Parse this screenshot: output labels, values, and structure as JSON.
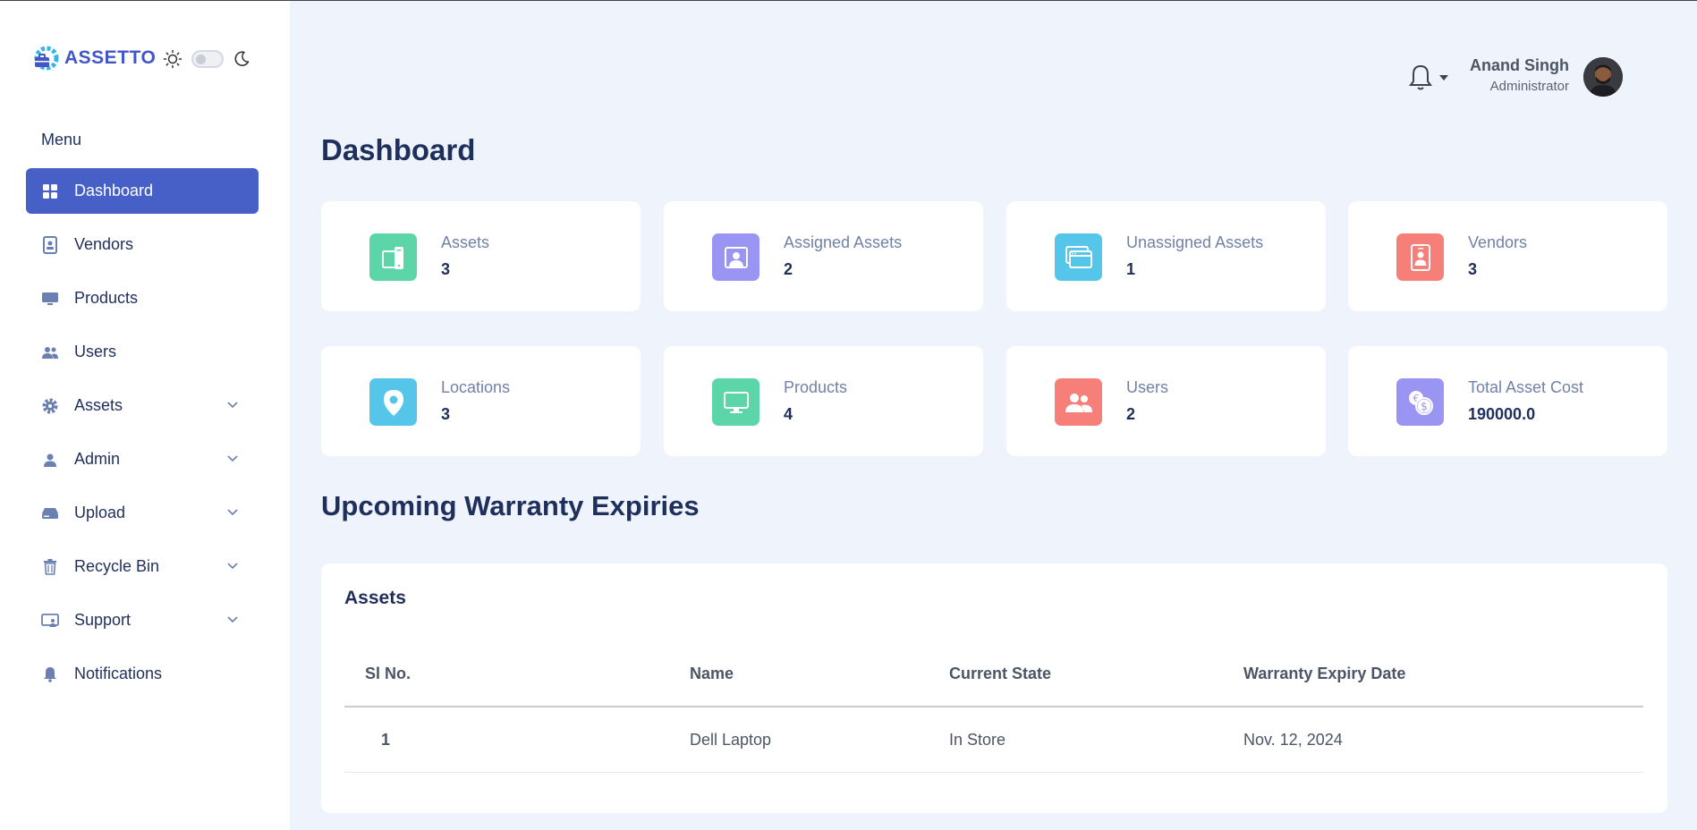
{
  "brand": {
    "name": "ASSETTO"
  },
  "sidebar": {
    "menu_title": "Menu",
    "items": [
      {
        "label": "Dashboard",
        "icon": "grid-icon",
        "active": true,
        "has_submenu": false
      },
      {
        "label": "Vendors",
        "icon": "id-badge-icon",
        "active": false,
        "has_submenu": false
      },
      {
        "label": "Products",
        "icon": "monitor-icon",
        "active": false,
        "has_submenu": false
      },
      {
        "label": "Users",
        "icon": "users-icon",
        "active": false,
        "has_submenu": false
      },
      {
        "label": "Assets",
        "icon": "gear-icon",
        "active": false,
        "has_submenu": true
      },
      {
        "label": "Admin",
        "icon": "user-icon",
        "active": false,
        "has_submenu": true
      },
      {
        "label": "Upload",
        "icon": "drive-icon",
        "active": false,
        "has_submenu": true
      },
      {
        "label": "Recycle Bin",
        "icon": "trash-icon",
        "active": false,
        "has_submenu": true
      },
      {
        "label": "Support",
        "icon": "support-icon",
        "active": false,
        "has_submenu": true
      },
      {
        "label": "Notifications",
        "icon": "bell-icon",
        "active": false,
        "has_submenu": false
      }
    ]
  },
  "header": {
    "user_name": "Anand Singh",
    "user_role": "Administrator"
  },
  "main": {
    "title": "Dashboard",
    "stats": [
      {
        "label": "Assets",
        "value": "3",
        "color": "#5cd6a8",
        "icon": "devices-icon"
      },
      {
        "label": "Assigned Assets",
        "value": "2",
        "color": "#9a94f2",
        "icon": "assigned-user-icon"
      },
      {
        "label": "Unassigned Assets",
        "value": "1",
        "color": "#55c5ea",
        "icon": "windows-icon"
      },
      {
        "label": "Vendors",
        "value": "3",
        "color": "#f77f7a",
        "icon": "vendor-badge-icon"
      },
      {
        "label": "Locations",
        "value": "3",
        "color": "#55c5ea",
        "icon": "location-pin-icon"
      },
      {
        "label": "Products",
        "value": "4",
        "color": "#5cd6a8",
        "icon": "monitor-icon"
      },
      {
        "label": "Users",
        "value": "2",
        "color": "#f77f7a",
        "icon": "users-icon"
      },
      {
        "label": "Total Asset Cost",
        "value": "190000.0",
        "color": "#9a94f2",
        "icon": "coins-icon"
      }
    ],
    "warranty": {
      "title": "Upcoming Warranty Expiries",
      "caption": "Assets",
      "columns": [
        "Sl No.",
        "Name",
        "Current State",
        "Warranty Expiry Date"
      ],
      "rows": [
        [
          "1",
          "Dell Laptop",
          "In Store",
          "Nov. 12, 2024"
        ]
      ]
    }
  },
  "colors": {
    "accent": "#4660c8",
    "brand": "#4257c7",
    "background": "#eef3fc"
  }
}
